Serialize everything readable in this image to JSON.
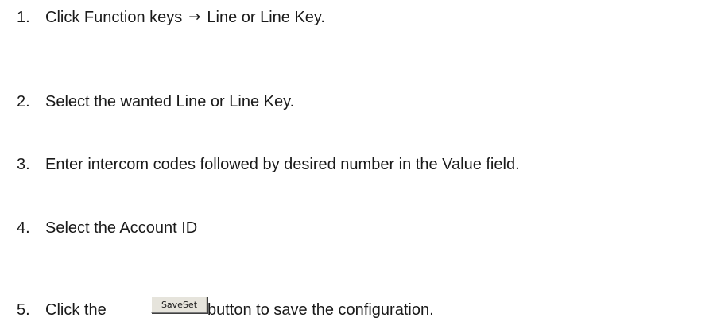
{
  "steps": [
    {
      "number": "1.",
      "text_before": "Click Function keys",
      "arrow": "→",
      "text_after": "Line or Line Key."
    },
    {
      "number": "2.",
      "text": "Select the wanted Line or Line Key."
    },
    {
      "number": "3.",
      "text": "Enter intercom codes followed by desired number in the Value field."
    },
    {
      "number": "4.",
      "text": "Select the Account ID"
    },
    {
      "number": "5.",
      "text_before": "Click the",
      "button_label": "SaveSet",
      "text_after": "button to save the configuration."
    }
  ]
}
